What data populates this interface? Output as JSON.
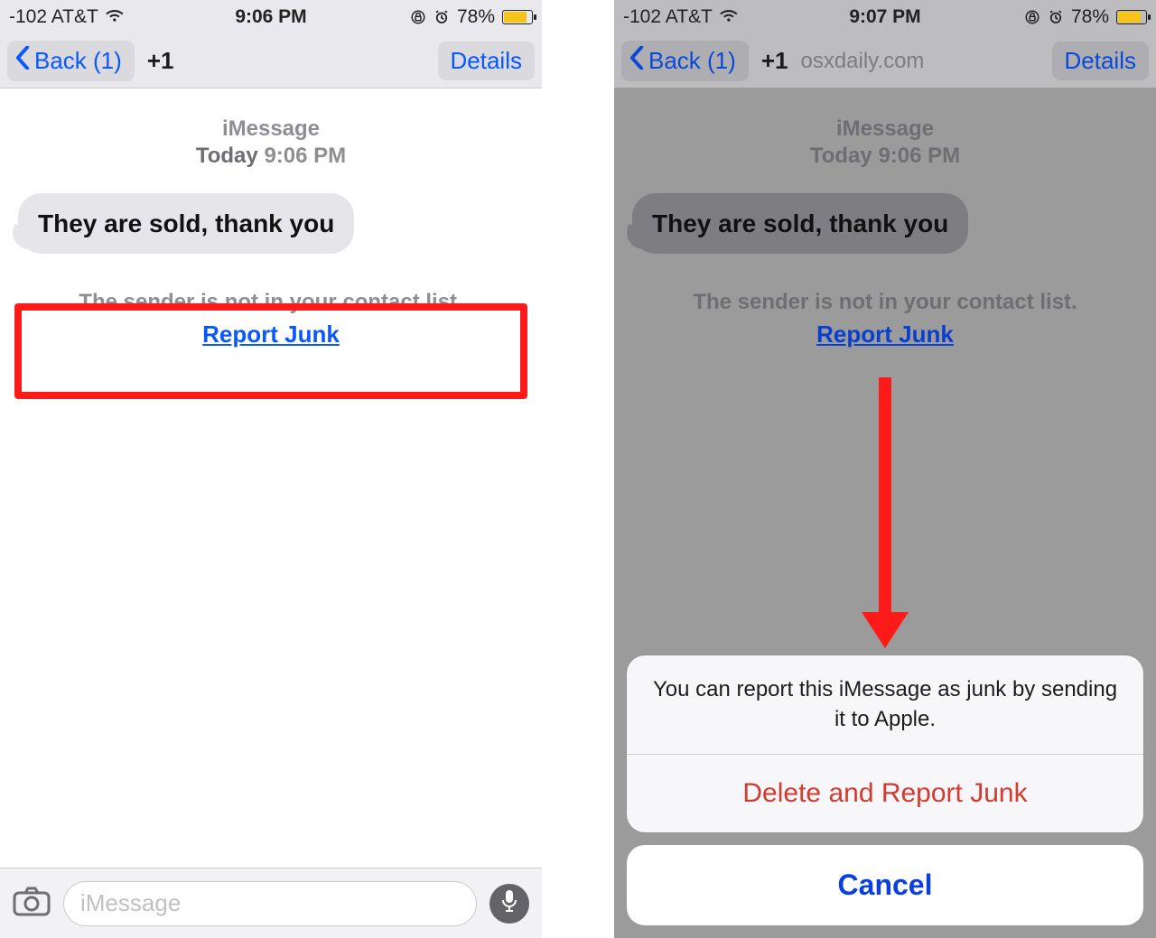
{
  "left": {
    "statusbar": {
      "carrier": "-102 AT&T",
      "time": "9:06 PM",
      "battery_pct": "78%"
    },
    "nav": {
      "back_label": "Back (1)",
      "contact": "+1",
      "details_label": "Details"
    },
    "thread": {
      "service_label": "iMessage",
      "day_label": "Today",
      "time_label": "9:06 PM",
      "message": "They are sold, thank you",
      "notice": "The sender is not in your contact list.",
      "report_link": "Report Junk"
    },
    "compose": {
      "placeholder": "iMessage"
    }
  },
  "right": {
    "statusbar": {
      "carrier": "-102 AT&T",
      "time": "9:07 PM",
      "battery_pct": "78%"
    },
    "nav": {
      "back_label": "Back (1)",
      "contact": "+1",
      "domain": "osxdaily.com",
      "details_label": "Details"
    },
    "thread": {
      "service_label": "iMessage",
      "day_label": "Today",
      "time_label": "9:06 PM",
      "message": "They are sold, thank you",
      "notice": "The sender is not in your contact list.",
      "report_link": "Report Junk"
    },
    "action_sheet": {
      "message": "You can report this iMessage as junk by sending it to Apple.",
      "destructive": "Delete and Report Junk",
      "cancel": "Cancel"
    }
  }
}
